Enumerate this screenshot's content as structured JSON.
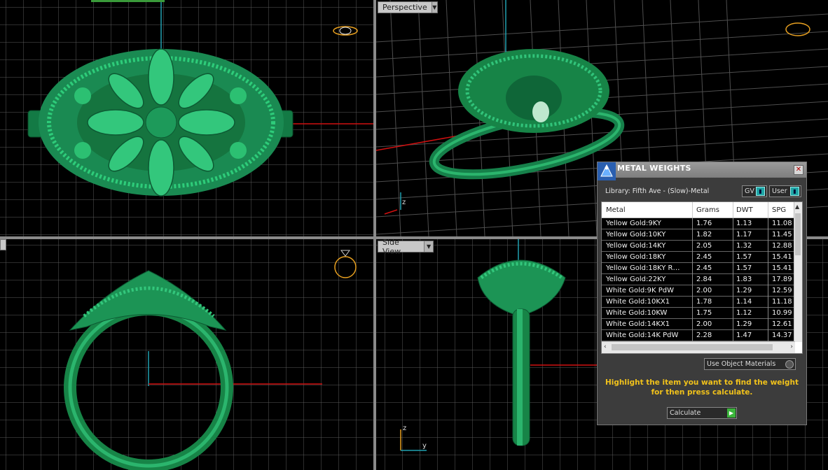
{
  "viewports": {
    "top": {
      "label": ""
    },
    "perspective": {
      "label": "Perspective"
    },
    "front": {
      "label": ""
    },
    "side": {
      "label": "Side View"
    }
  },
  "axes": {
    "z": "z",
    "y": "y"
  },
  "metal_weights": {
    "title": "METAL WEIGHTS",
    "close": "✕",
    "library": "Library: Fifth Ave - (Slow)-Metal",
    "gv_label": "GV",
    "user_label": "User",
    "columns": [
      "Metal",
      "Grams",
      "DWT",
      "SPG"
    ],
    "rows": [
      {
        "metal": "Yellow Gold:9KY",
        "grams": "1.76",
        "dwt": "1.13",
        "spg": "11.08"
      },
      {
        "metal": "Yellow Gold:10KY",
        "grams": "1.82",
        "dwt": "1.17",
        "spg": "11.45"
      },
      {
        "metal": "Yellow Gold:14KY",
        "grams": "2.05",
        "dwt": "1.32",
        "spg": "12.88"
      },
      {
        "metal": "Yellow Gold:18KY",
        "grams": "2.45",
        "dwt": "1.57",
        "spg": "15.41"
      },
      {
        "metal": "Yellow Gold:18KY R…",
        "grams": "2.45",
        "dwt": "1.57",
        "spg": "15.41"
      },
      {
        "metal": "Yellow Gold:22KY",
        "grams": "2.84",
        "dwt": "1.83",
        "spg": "17.89"
      },
      {
        "metal": "White Gold:9K PdW",
        "grams": "2.00",
        "dwt": "1.29",
        "spg": "12.59"
      },
      {
        "metal": "White Gold:10KX1",
        "grams": "1.78",
        "dwt": "1.14",
        "spg": "11.18"
      },
      {
        "metal": "White Gold:10KW",
        "grams": "1.75",
        "dwt": "1.12",
        "spg": "10.99"
      },
      {
        "metal": "White Gold:14KX1",
        "grams": "2.00",
        "dwt": "1.29",
        "spg": "12.61"
      },
      {
        "metal": "White Gold:14K PdW",
        "grams": "2.28",
        "dwt": "1.47",
        "spg": "14.37"
      }
    ],
    "use_object_materials": "Use Object Materials",
    "hint": "Highlight the item you want to find the weight for then press calculate.",
    "calculate": "Calculate"
  },
  "colors": {
    "ring": "#1f9c5e",
    "ring_dark": "#0d5a33",
    "grid": "#5a5a5a",
    "axis_red": "#d01010",
    "axis_cyan": "#20a0b0",
    "hint": "#f1c21b"
  }
}
